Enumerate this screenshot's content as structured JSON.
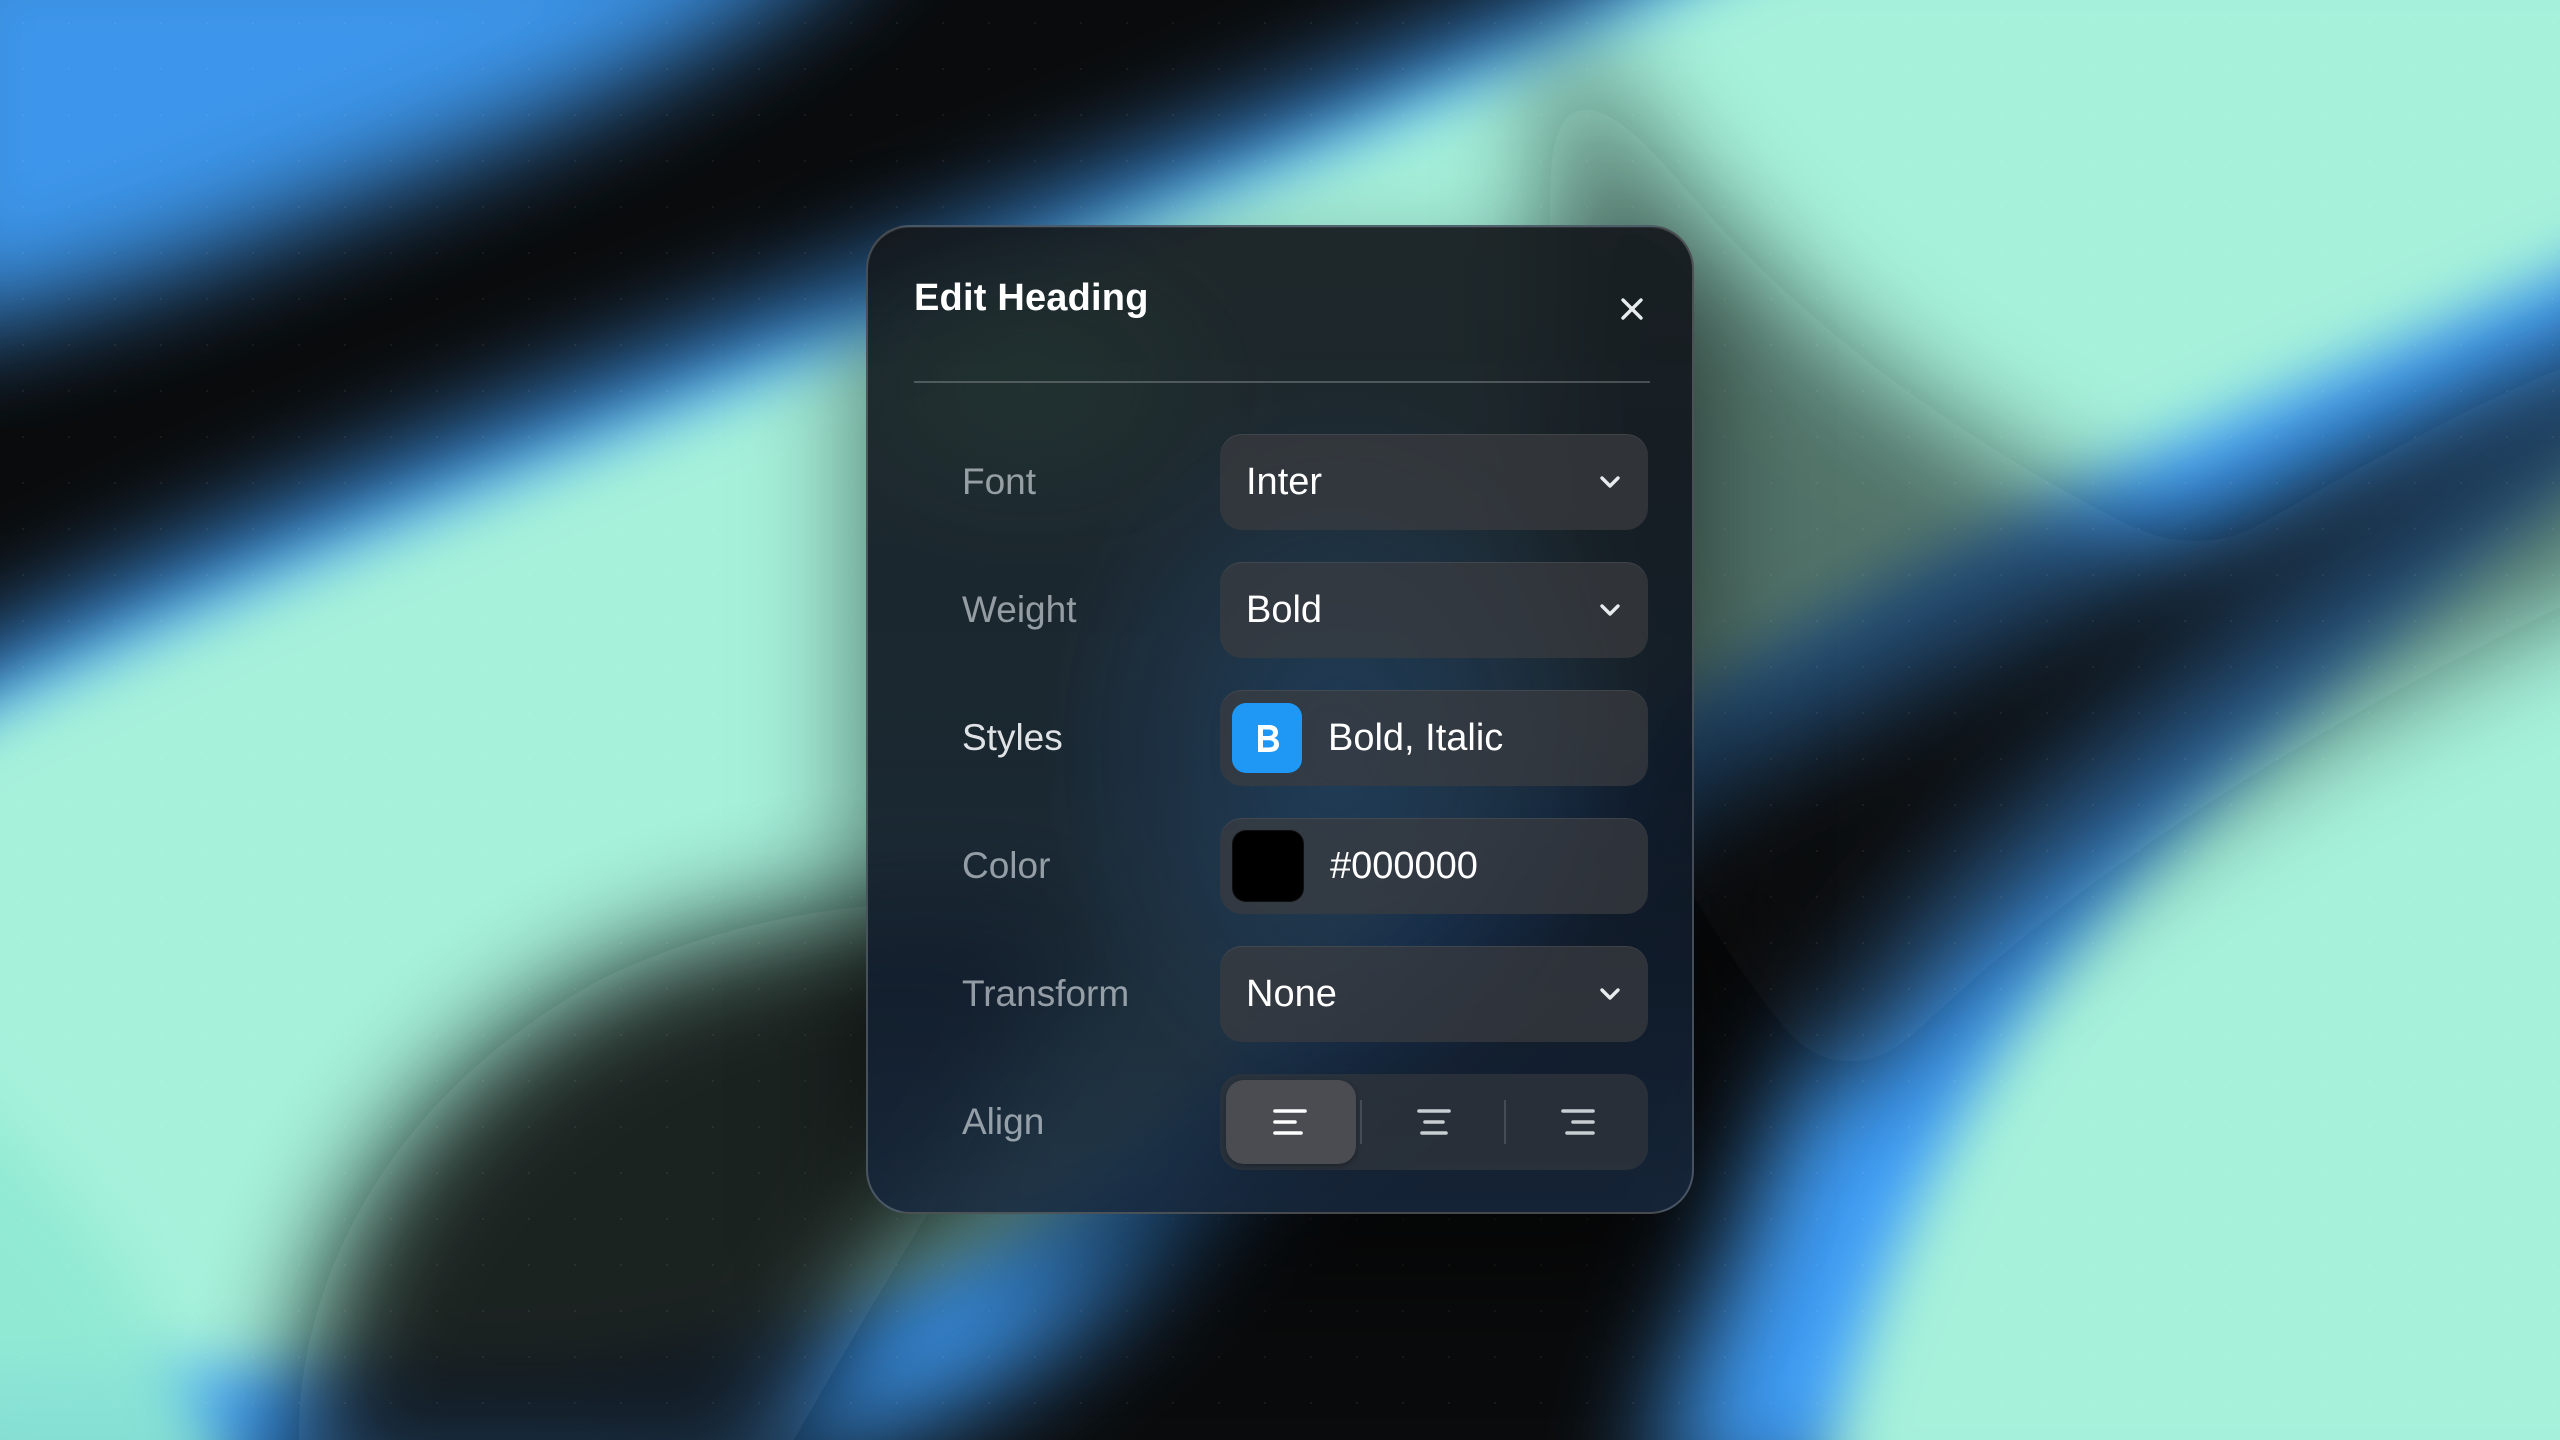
{
  "dialog": {
    "title": "Edit Heading",
    "close_icon": "close-icon"
  },
  "fields": {
    "font": {
      "label": "Font",
      "value": "Inter",
      "icon": "chevron-down-icon"
    },
    "weight": {
      "label": "Weight",
      "value": "Bold",
      "icon": "chevron-down-icon"
    },
    "styles": {
      "label": "Styles",
      "value": "Bold, Italic",
      "icon": "bold-icon",
      "chip_color": "#1f97f5"
    },
    "color": {
      "label": "Color",
      "value": "#000000",
      "swatch_color": "#000000"
    },
    "transform": {
      "label": "Transform",
      "value": "None",
      "icon": "chevron-down-icon"
    },
    "align": {
      "label": "Align",
      "options": [
        "align-left-icon",
        "align-center-icon",
        "align-right-icon"
      ],
      "selected": "left"
    }
  },
  "colors": {
    "accent": "#1f97f5",
    "mint": "#a7f3d8",
    "sky": "#4aa9f8",
    "background": "#0a0b0c"
  }
}
